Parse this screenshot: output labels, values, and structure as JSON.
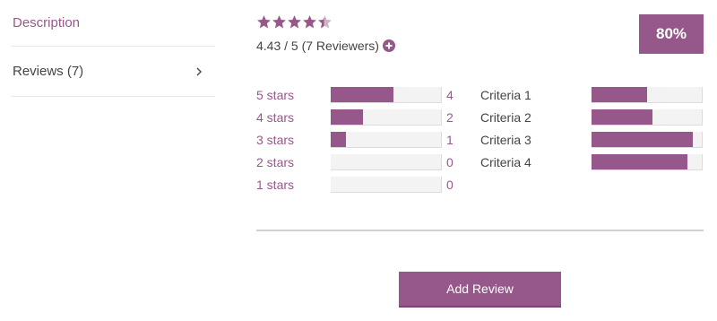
{
  "sidebar": {
    "items": [
      {
        "label": "Description"
      },
      {
        "label": "Reviews (7)"
      }
    ]
  },
  "summary": {
    "stars_rating": 4.43,
    "stars_max": 5,
    "average_text": "4.43 / 5 (7 Reviewers)",
    "percent_badge": "80%"
  },
  "rating_breakdown": [
    {
      "label": "5 stars",
      "count": "4",
      "fill": 0.57
    },
    {
      "label": "4 stars",
      "count": "2",
      "fill": 0.29
    },
    {
      "label": "3 stars",
      "count": "1",
      "fill": 0.14
    },
    {
      "label": "2 stars",
      "count": "0",
      "fill": 0
    },
    {
      "label": "1 stars",
      "count": "0",
      "fill": 0
    }
  ],
  "criteria": [
    {
      "label": "Criteria 1",
      "fill": 0.5
    },
    {
      "label": "Criteria 2",
      "fill": 0.55
    },
    {
      "label": "Criteria 3",
      "fill": 0.92
    },
    {
      "label": "Criteria 4",
      "fill": 0.87
    }
  ],
  "actions": {
    "add_review_label": "Add Review"
  },
  "colors": {
    "accent": "#96588a",
    "track": "#f3f3f3"
  }
}
